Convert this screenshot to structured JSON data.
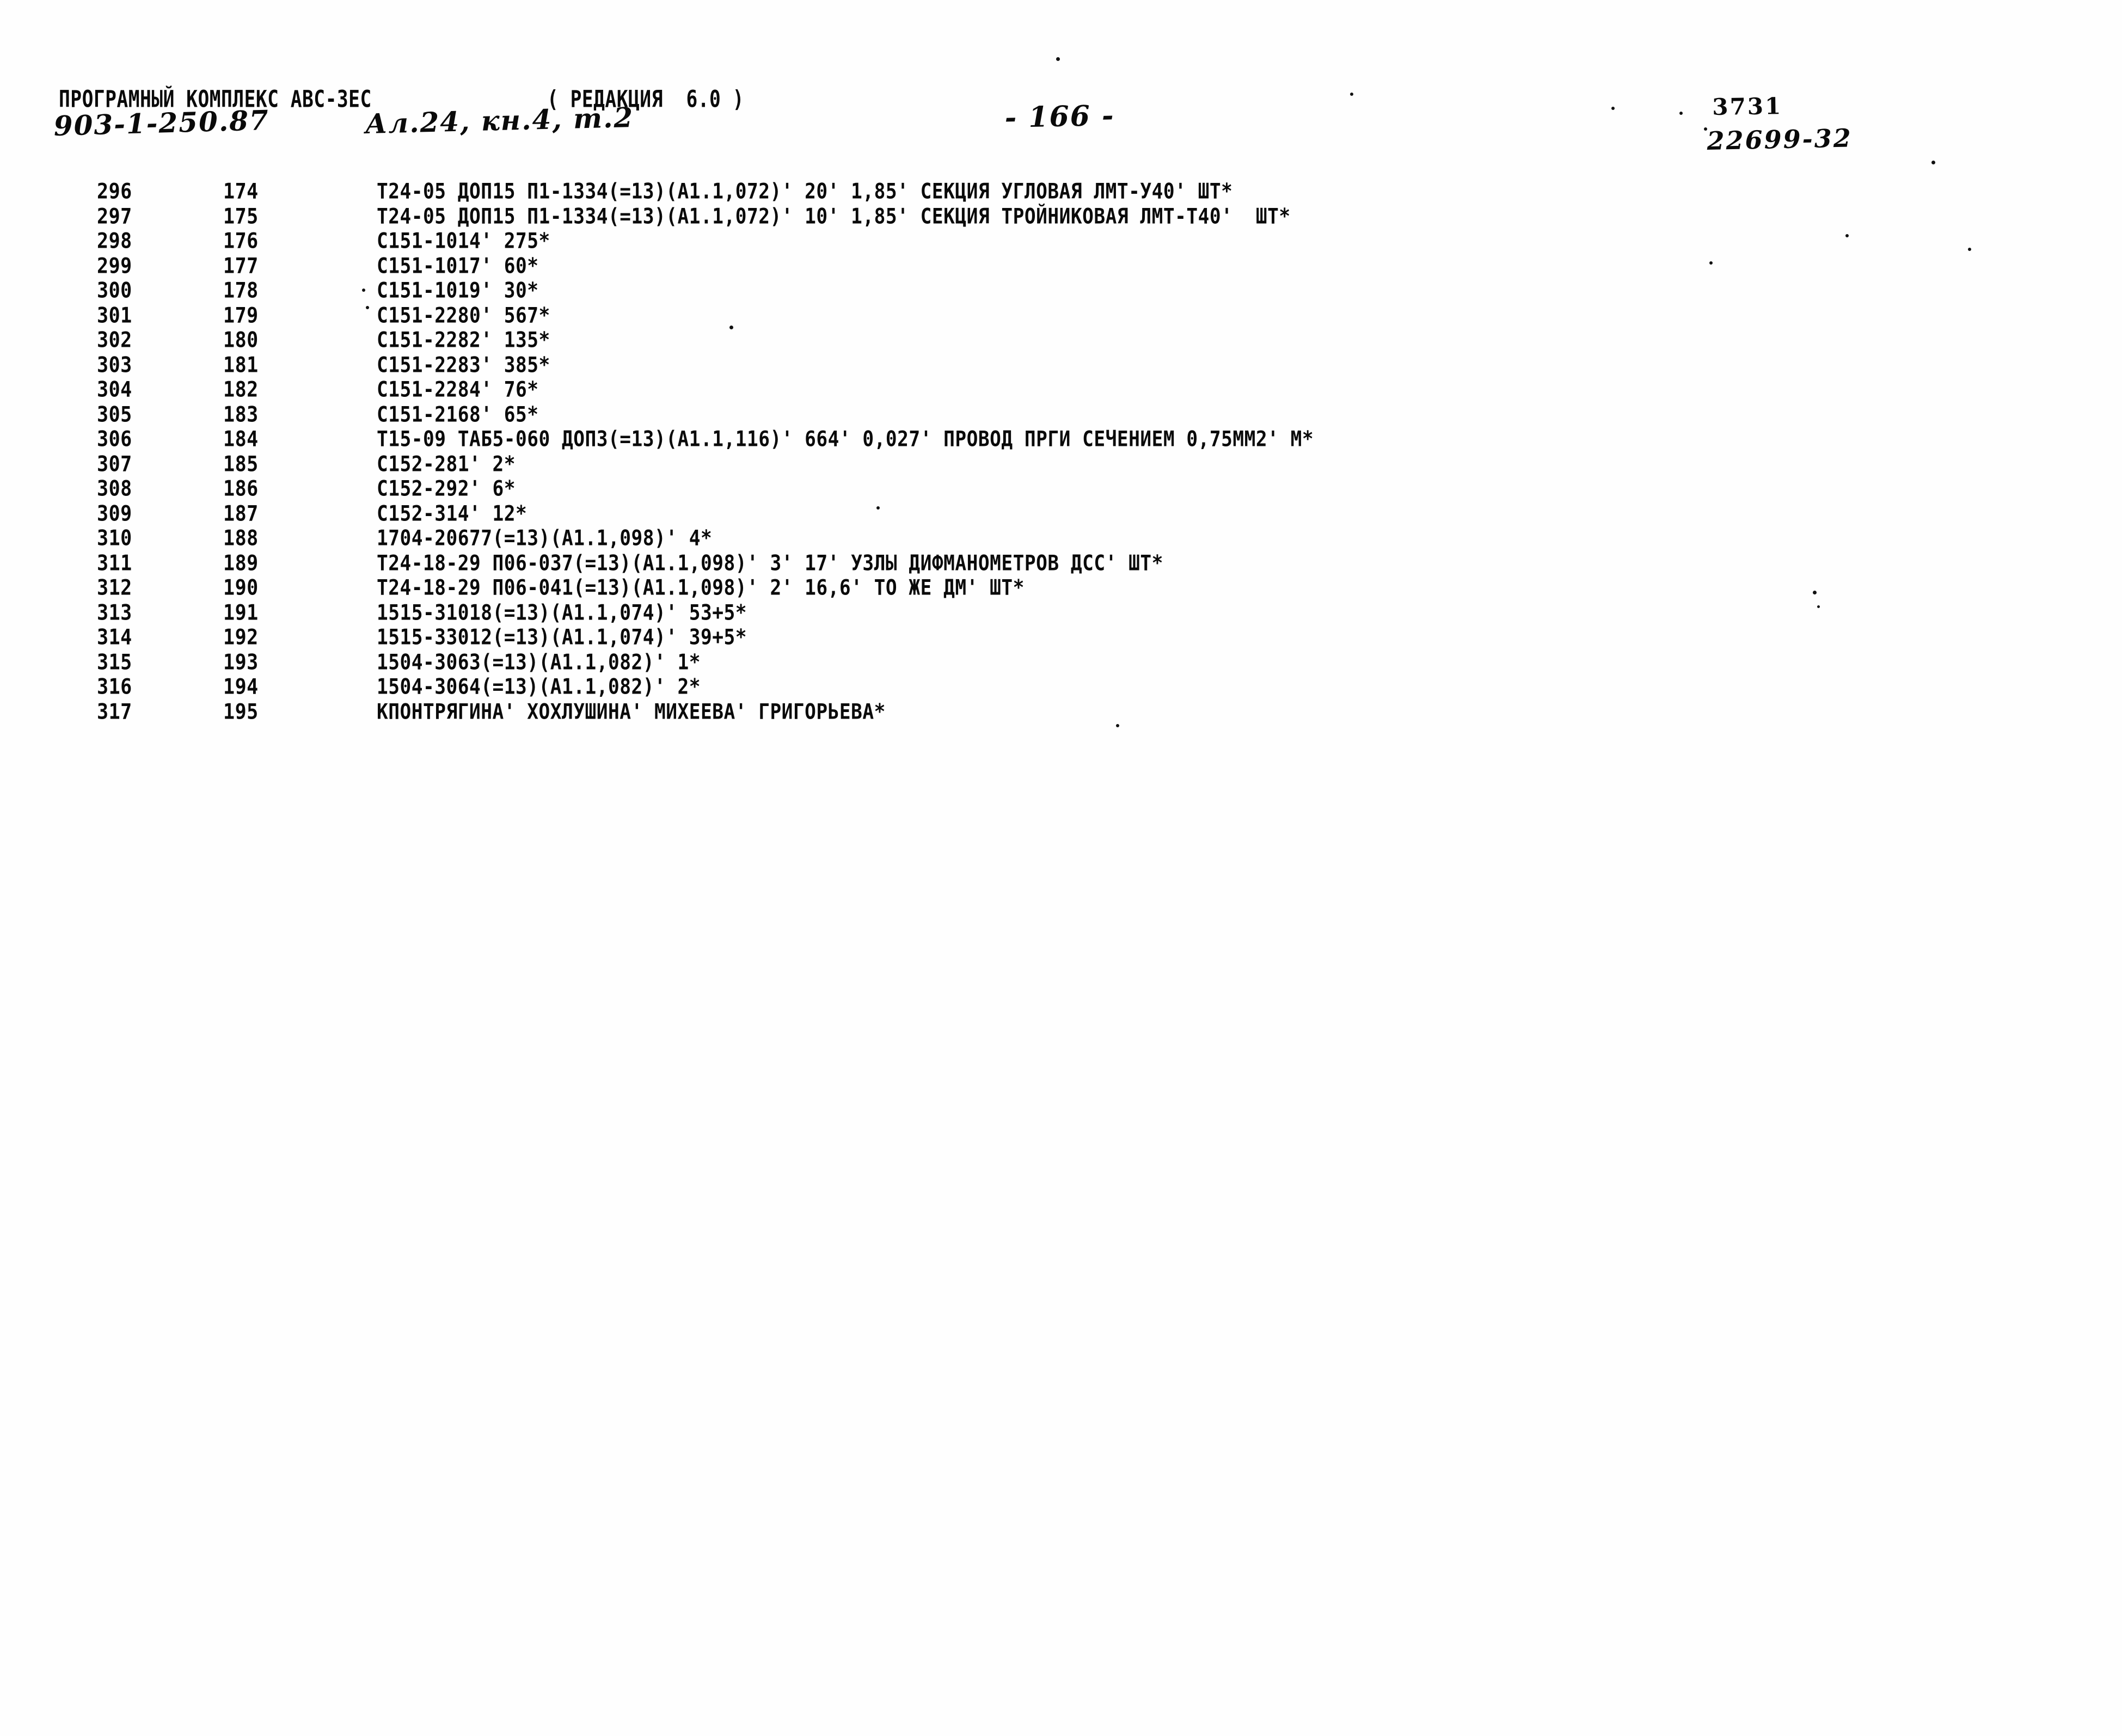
{
  "header": {
    "program_title": "ПРОГРАМНЫЙ КОМПЛЕКС АВС-ЗЕС",
    "revision_label": "( РЕДАКЦИЯ  6.0 )",
    "doc_code": "903-1-250.87",
    "doc_part": "Ал.24, кн.4, т.2",
    "page_number": "- 166 -",
    "sheet_number": "3731",
    "archive_number": "22699-32"
  },
  "listing": {
    "rows": [
      {
        "seq": "296",
        "pos": "174",
        "body": "Т24-05 ДОП15 П1-1334(=13)(А1.1,072)' 20' 1,85' СЕКЦИЯ УГЛОВАЯ ЛМТ-У40' ШТ*"
      },
      {
        "seq": "297",
        "pos": "175",
        "body": "Т24-05 ДОП15 П1-1334(=13)(А1.1,072)' 10' 1,85' СЕКЦИЯ ТРОЙНИКОВАЯ ЛМТ-Т40'  ШТ*"
      },
      {
        "seq": "298",
        "pos": "176",
        "body": "С151-1014' 275*"
      },
      {
        "seq": "299",
        "pos": "177",
        "body": "С151-1017' 60*"
      },
      {
        "seq": "300",
        "pos": "178",
        "body": "С151-1019' 30*"
      },
      {
        "seq": "301",
        "pos": "179",
        "body": "С151-2280' 567*"
      },
      {
        "seq": "302",
        "pos": "180",
        "body": "С151-2282' 135*"
      },
      {
        "seq": "303",
        "pos": "181",
        "body": "С151-2283' 385*"
      },
      {
        "seq": "304",
        "pos": "182",
        "body": "С151-2284' 76*"
      },
      {
        "seq": "305",
        "pos": "183",
        "body": "С151-2168' 65*"
      },
      {
        "seq": "306",
        "pos": "184",
        "body": "Т15-09 ТАБ5-060 ДОП3(=13)(А1.1,116)' 664' 0,027' ПРОВОД ПРГИ СЕЧЕНИЕМ 0,75ММ2' М*"
      },
      {
        "seq": "307",
        "pos": "185",
        "body": "С152-281' 2*"
      },
      {
        "seq": "308",
        "pos": "186",
        "body": "С152-292' 6*"
      },
      {
        "seq": "309",
        "pos": "187",
        "body": "С152-314' 12*"
      },
      {
        "seq": "310",
        "pos": "188",
        "body": "1704-20677(=13)(А1.1,098)' 4*"
      },
      {
        "seq": "311",
        "pos": "189",
        "body": "Т24-18-29 П06-037(=13)(А1.1,098)' 3' 17' УЗЛЫ ДИФМАНОМЕТРОВ ДСС' ШТ*"
      },
      {
        "seq": "312",
        "pos": "190",
        "body": "Т24-18-29 П06-041(=13)(А1.1,098)' 2' 16,6' ТО ЖЕ ДМ' ШТ*"
      },
      {
        "seq": "313",
        "pos": "191",
        "body": "1515-31018(=13)(А1.1,074)' 53+5*"
      },
      {
        "seq": "314",
        "pos": "192",
        "body": "1515-33012(=13)(А1.1,074)' 39+5*"
      },
      {
        "seq": "315",
        "pos": "193",
        "body": "1504-3063(=13)(А1.1,082)' 1*"
      },
      {
        "seq": "316",
        "pos": "194",
        "body": "1504-3064(=13)(А1.1,082)' 2*"
      },
      {
        "seq": "317",
        "pos": "195",
        "body": "КПОНТРЯГИНА' ХОХЛУШИНА' МИХЕЕВА' ГРИГОРЬЕВА*"
      }
    ]
  },
  "colors": {
    "ink": "#0a0a0a",
    "paper": "#fefefe"
  }
}
